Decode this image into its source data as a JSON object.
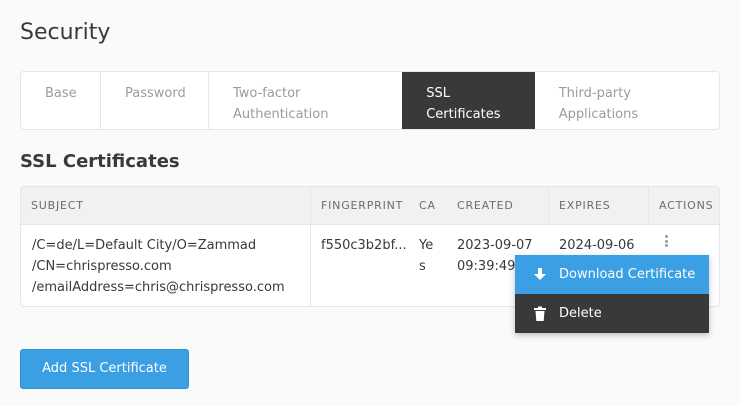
{
  "page": {
    "title": "Security"
  },
  "tabs": [
    {
      "line1": "Base",
      "line2": ""
    },
    {
      "line1": "Password",
      "line2": ""
    },
    {
      "line1": "Two-factor",
      "line2": "Authentication"
    },
    {
      "line1": "SSL",
      "line2": "Certificates",
      "active": true
    },
    {
      "line1": "Third-party",
      "line2": "Applications"
    }
  ],
  "section": {
    "title": "SSL Certificates"
  },
  "table": {
    "headers": {
      "subject": "SUBJECT",
      "fingerprint": "FINGERPRINT",
      "ca": "CA",
      "created": "CREATED",
      "expires": "EXPIRES",
      "actions": "ACTIONS"
    },
    "rows": [
      {
        "subject": [
          "/C=de/L=Default City/O=Zammad",
          "/CN=chrispresso.com",
          "/emailAddress=chris@chrispresso.com"
        ],
        "fingerprint": "f550c3b2bf...",
        "ca": [
          "Ye",
          "s"
        ],
        "created": [
          "2023-09-07",
          "09:39:49"
        ],
        "expires": "2024-09-06",
        "actions_icon": "kebab-menu-icon"
      }
    ]
  },
  "menu": {
    "download": {
      "label": "Download Certificate",
      "icon": "download-icon"
    },
    "delete": {
      "label": "Delete",
      "icon": "trash-icon"
    }
  },
  "add_button": {
    "label": "Add SSL Certificate"
  },
  "colors": {
    "accent": "#3b9fe3",
    "dark": "#38393a",
    "muted": "#9a9c9e",
    "border": "#e4e6e7"
  }
}
